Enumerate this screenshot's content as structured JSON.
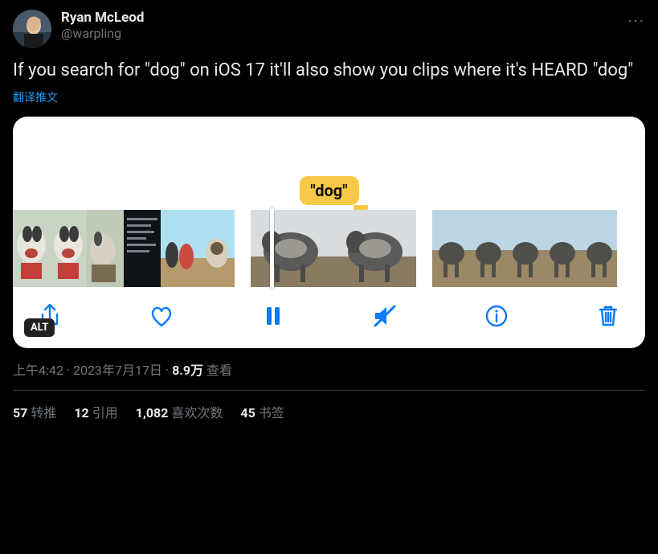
{
  "author": {
    "display_name": "Ryan McLeod",
    "handle": "@warpling"
  },
  "more_label": "···",
  "body": "If you search for \"dog\" on iOS 17 it'll also show you clips where it's HEARD \"dog\"",
  "translate_label": "翻译推文",
  "media": {
    "bubble_text": "\"dog\"",
    "alt_badge": "ALT",
    "toolbar": {
      "share": "share",
      "like": "like",
      "pause": "pause",
      "mute": "mute",
      "info": "info",
      "trash": "trash"
    }
  },
  "meta": {
    "time": "上午4:42",
    "dot1": " · ",
    "date": "2023年7月17日",
    "dot2": " · ",
    "views_number": "8.9万",
    "views_label": " 查看"
  },
  "stats": {
    "retweets_n": "57",
    "retweets_l": "转推",
    "quotes_n": "12",
    "quotes_l": "引用",
    "likes_n": "1,082",
    "likes_l": "喜欢次数",
    "bookmarks_n": "45",
    "bookmarks_l": "书签"
  }
}
